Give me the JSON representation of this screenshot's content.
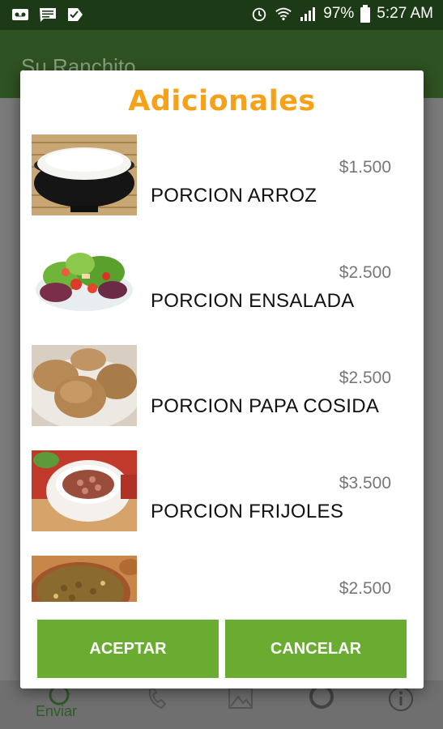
{
  "statusbar": {
    "battery": "97%",
    "time": "5:27 AM"
  },
  "app": {
    "title": "Su Ranchito"
  },
  "bottomnav": {
    "send_label": "Enviar"
  },
  "dialog": {
    "title": "Adicionales",
    "items": [
      {
        "name": "PORCION ARROZ",
        "price": "$1.500"
      },
      {
        "name": "PORCION ENSALADA",
        "price": "$2.500"
      },
      {
        "name": "PORCION PAPA COSIDA",
        "price": "$2.500"
      },
      {
        "name": "PORCION FRIJOLES",
        "price": "$3.500"
      },
      {
        "name": "",
        "price": "$2.500"
      }
    ],
    "accept_label": "ACEPTAR",
    "cancel_label": "CANCELAR"
  },
  "colors": {
    "accent": "#6aab32",
    "title": "#f5a11a",
    "appbar": "#2f5222",
    "statusbar": "#1c3a16"
  }
}
